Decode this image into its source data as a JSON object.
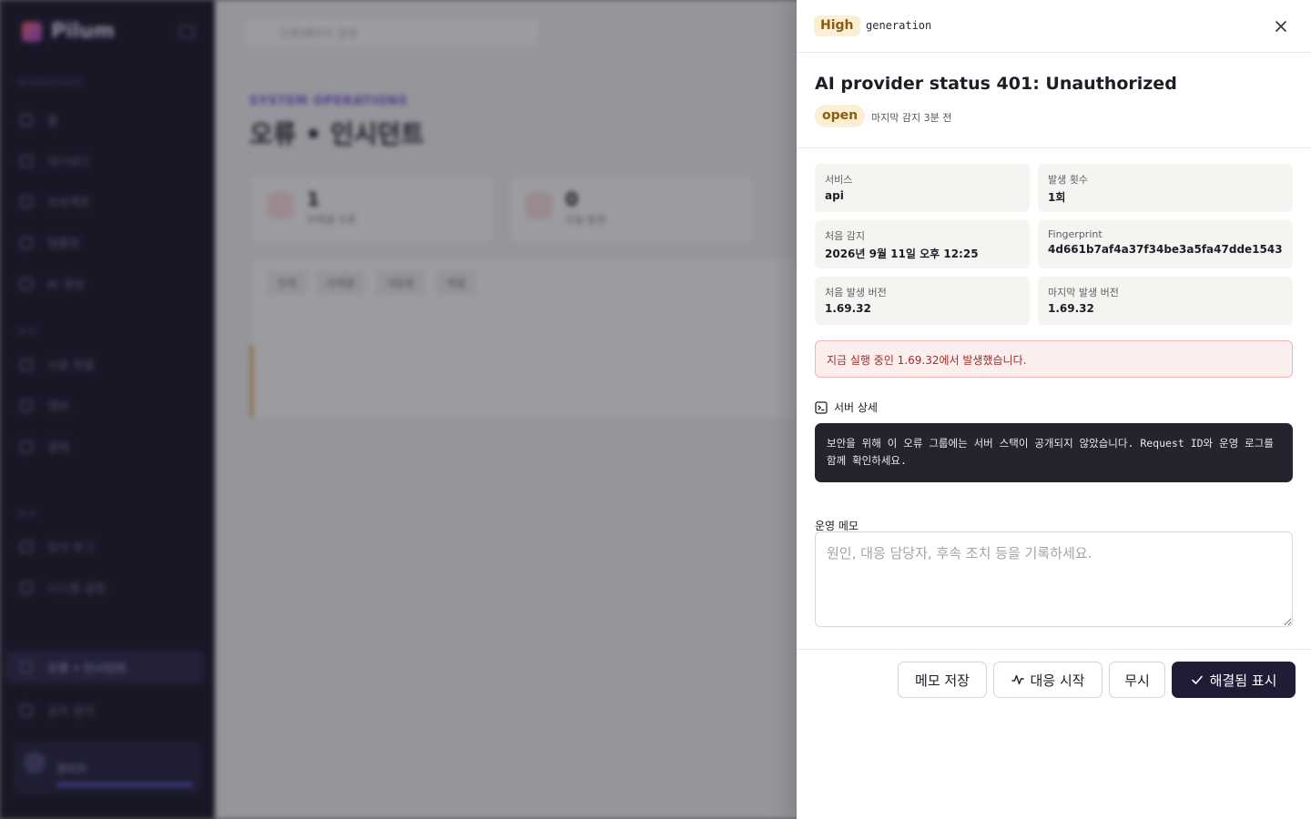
{
  "background": {
    "app_name": "Pilum",
    "search_placeholder": "오류/페이지 검색",
    "eyebrow": "SYSTEM OPERATIONS",
    "page_title": "오류 • 인시던트",
    "nav_section_1": "WORKSPACE",
    "nav_section_2": "관리",
    "nav_section_3": "운영",
    "nav_items": [
      "홈",
      "대시보드",
      "프로젝트",
      "템플릿",
      "AI 생성",
      "사용 현황",
      "멤버",
      "결제",
      "감사 로그",
      "시스템 설정",
      "오류 • 인시던트",
      "공지 관리"
    ],
    "cards": [
      {
        "value": "1",
        "label": "미해결 오류"
      },
      {
        "value": "0",
        "label": "오늘 발생"
      }
    ],
    "filters": [
      "전체",
      "미해결",
      "대응중",
      "해결"
    ],
    "user_name": "관리자"
  },
  "drawer": {
    "severity": "High",
    "category": "generation",
    "close_label": "닫기",
    "title": "AI provider status 401: Unauthorized",
    "status": "open",
    "last_seen": "마지막 감지 3분 전",
    "details": [
      {
        "key": "서비스",
        "value": "api"
      },
      {
        "key": "발생 횟수",
        "value": "1회"
      },
      {
        "key": "처음 감지",
        "value": "2026년 9월 11일 오후 12:25"
      },
      {
        "key": "Fingerprint",
        "value": "4d661b7af4a37f34be3a5fa47dde1543"
      },
      {
        "key": "처음 발생 버전",
        "value": "1.69.32"
      },
      {
        "key": "마지막 발생 버전",
        "value": "1.69.32"
      }
    ],
    "alert": "지금 실행 중인 1.69.32에서 발생했습니다.",
    "server_detail_label": "서버 상세",
    "server_detail_text": "보안을 위해 이 오류 그룹에는 서버 스택이 공개되지 않았습니다. Request ID와 운영 로그를 함께 확인하세요.",
    "memo_label": "운영 메모",
    "memo_placeholder": "원인, 대응 담당자, 후속 조치 등을 기록하세요.",
    "memo_value": "",
    "buttons": {
      "save_memo": "메모 저장",
      "start_response": "대응 시작",
      "ignore": "무시",
      "resolve": "해결됨 표시"
    },
    "colors": {
      "badge_bg": "#fbefd3",
      "badge_text": "#8d5b12",
      "alert_bg": "#fdeeee",
      "primary": "#1f1d36"
    }
  }
}
